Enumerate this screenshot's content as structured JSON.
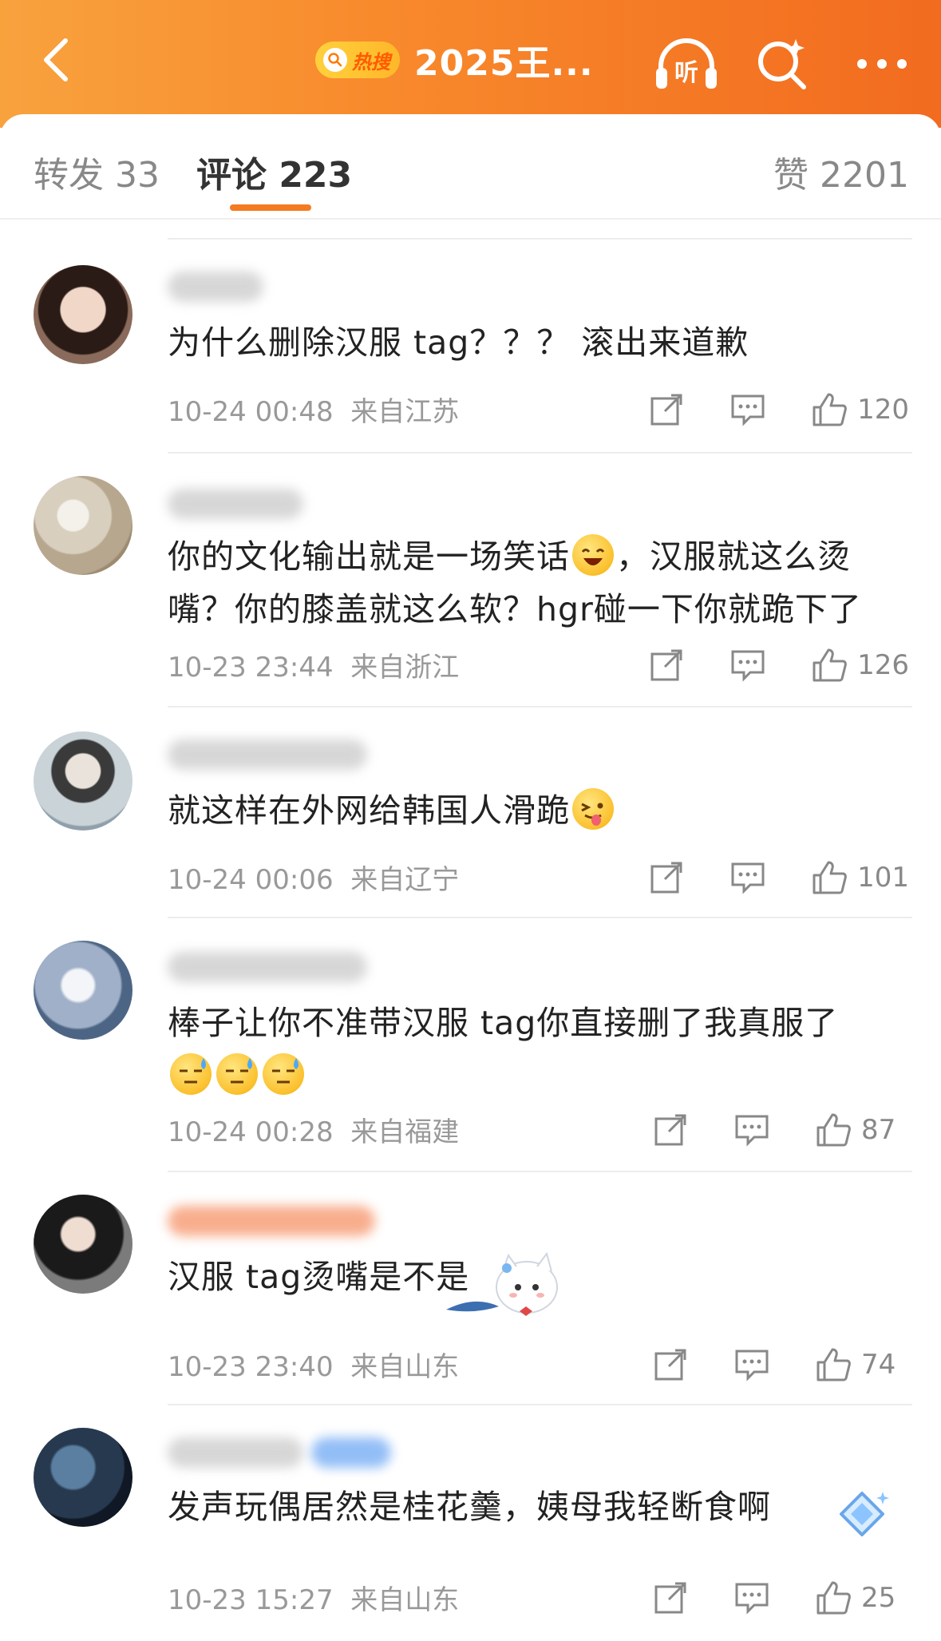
{
  "header": {
    "hot_badge": "热搜",
    "title": "2025王...",
    "icons": [
      "back-icon",
      "listen-icon",
      "search-icon",
      "more-icon"
    ],
    "listen_label": "听"
  },
  "tabs": {
    "repost": "转发 33",
    "comments": "评论 223",
    "likes": "赞 2201"
  },
  "colors": {
    "accent": "#f47b20",
    "header_start": "#f8a23e",
    "header_end": "#f26b1f"
  },
  "comments": [
    {
      "text": "为什么删除汉服 tag？？？ 滚出来道歉",
      "time": "10-24 00:48",
      "location": "来自江苏",
      "likes": "120"
    },
    {
      "text_a": "你的文化输出就是一场笑话",
      "text_b": "，汉服就这么烫嘴？你的膝盖就这么软？hgr碰一下你就跪下了",
      "time": "10-23 23:44",
      "location": "来自浙江",
      "likes": "126"
    },
    {
      "text": "就这样在外网给韩国人滑跪",
      "time": "10-24 00:06",
      "location": "来自辽宁",
      "likes": "101"
    },
    {
      "text": "棒子让你不准带汉服 tag你直接删了我真服了",
      "time": "10-24 00:28",
      "location": "来自福建",
      "likes": "87"
    },
    {
      "text": "汉服 tag烫嘴是不是",
      "time": "10-23 23:40",
      "location": "来自山东",
      "likes": "74"
    },
    {
      "text": "发声玩偶居然是桂花羹，姨母我轻断食啊",
      "time": "10-23 15:27",
      "location": "来自山东",
      "likes": "25"
    }
  ]
}
